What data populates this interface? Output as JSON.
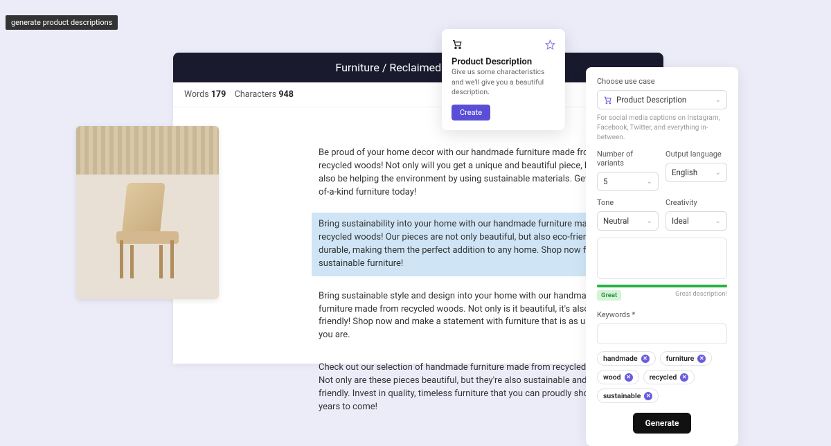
{
  "tooltip": "generate product descriptions",
  "header": {
    "breadcrumb": "Furniture / Reclaimed Wood Chair"
  },
  "stats": {
    "words_label": "Words",
    "words": "179",
    "chars_label": "Characters",
    "chars": "948"
  },
  "descriptions": [
    "Be proud of your home decor with our handmade furniture made from recycled woods! Not only will you get a unique and beautiful piece, but you'll also be helping the environment by using sustainable materials. Get your one-of-a-kind furniture today!",
    "Bring sustainability into your home with our handmade furniture made from recycled woods! Our pieces are not only beautiful, but also eco-friendly and durable, making them the perfect addition to any home. Shop now for stylish, sustainable furniture!",
    "Bring sustainable style and design into your home with our handmade furniture made from recycled woods. Not only is it beautiful, it's also eco-friendly! Shop now and make a statement with furniture that is as unique as you are.",
    "Check out our selection of handmade furniture made from recycled woods. Not only are these pieces beautiful, but they're also sustainable and eco-friendly. Invest in quality, timeless furniture that you can proudly show off for years to come!"
  ],
  "popover": {
    "title": "Product Description",
    "text": "Give us some characteristics and we'll give you a beautiful description.",
    "create_label": "Create"
  },
  "side": {
    "use_case_label": "Choose use case",
    "use_case_value": "Product Description",
    "help_text": "For social media captions on Instagram, Facebook, Twitter, and everything in-between.",
    "variants_label": "Number of variants",
    "variants_value": "5",
    "lang_label": "Output language",
    "lang_value": "English",
    "tone_label": "Tone",
    "tone_value": "Neutral",
    "creativity_label": "Creativity",
    "creativity_value": "Ideal",
    "great_label": "Great",
    "great_desc_label": "Great description!",
    "keywords_label": "Keywords *",
    "tags": [
      "handmade",
      "furniture",
      "wood",
      "recycled",
      "sustainable"
    ],
    "generate_label": "Generate"
  }
}
